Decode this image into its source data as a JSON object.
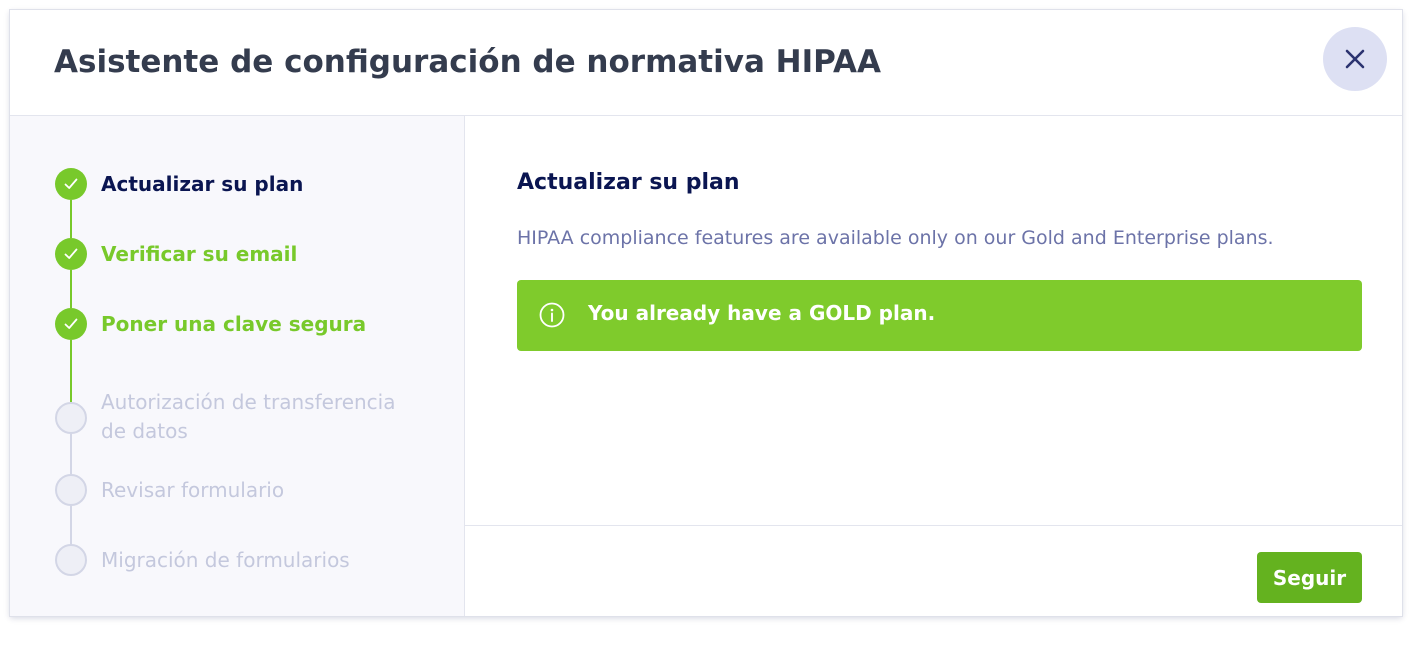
{
  "header": {
    "title": "Asistente de configuración de normativa HIPAA",
    "close_icon": "close-icon"
  },
  "steps": [
    {
      "label": "Actualizar su plan",
      "status": "current-complete"
    },
    {
      "label": "Verificar su email",
      "status": "complete"
    },
    {
      "label": "Poner una clave segura",
      "status": "complete"
    },
    {
      "label": "Autorización de transferencia de datos",
      "status": "pending"
    },
    {
      "label": "Revisar formulario",
      "status": "pending"
    },
    {
      "label": "Migración de formularios",
      "status": "pending"
    }
  ],
  "main": {
    "title": "Actualizar su plan",
    "description": "HIPAA compliance features are available only on our Gold and Enterprise plans.",
    "alert": {
      "icon": "info-icon",
      "text": "You already have a GOLD plan."
    },
    "continue_label": "Seguir"
  },
  "colors": {
    "success": "#78c92b",
    "alert_bg": "#7fcb2c",
    "button_bg": "#64b21f",
    "navy": "#0a1551",
    "muted": "#6c73a8",
    "pending": "#c4c8dd"
  }
}
